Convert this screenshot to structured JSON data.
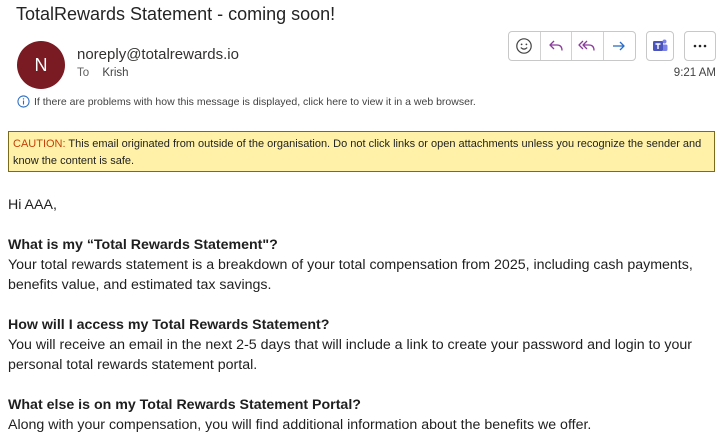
{
  "email": {
    "subject": "TotalRewards Statement - coming soon!",
    "avatar_initial": "N",
    "avatar_color": "#7a1a22",
    "sender": "noreply@totalrewards.io",
    "to_label": "To",
    "to_name": "Krish",
    "time": "9:21 AM",
    "info_message": "If there are problems with how this message is displayed, click here to view it in a web browser."
  },
  "toolbar": {
    "icons": [
      "emoji-icon",
      "reply-icon",
      "reply-all-icon",
      "forward-icon",
      "teams-icon",
      "more-icon"
    ],
    "accent": "#8a3a9a"
  },
  "caution": {
    "label": "CAUTION:",
    "text": " This email originated from outside of the organisation. Do not click links or open attachments unless you recognize the sender and know the content is safe."
  },
  "body": {
    "greeting": "Hi AAA,",
    "sections": [
      {
        "heading": "What is my “Total Rewards Statement\"?",
        "text": "Your total rewards statement is a breakdown of your total compensation from 2025, including cash payments, benefits value, and estimated tax savings."
      },
      {
        "heading": "How will I access my Total Rewards Statement?",
        "text": "You will receive an email in the next 2-5 days that will include a link to create your password and login to your personal total rewards statement portal."
      },
      {
        "heading": "What else is on my Total Rewards Statement Portal?",
        "text": "Along with your compensation, you will find additional information about the benefits we offer."
      }
    ]
  }
}
